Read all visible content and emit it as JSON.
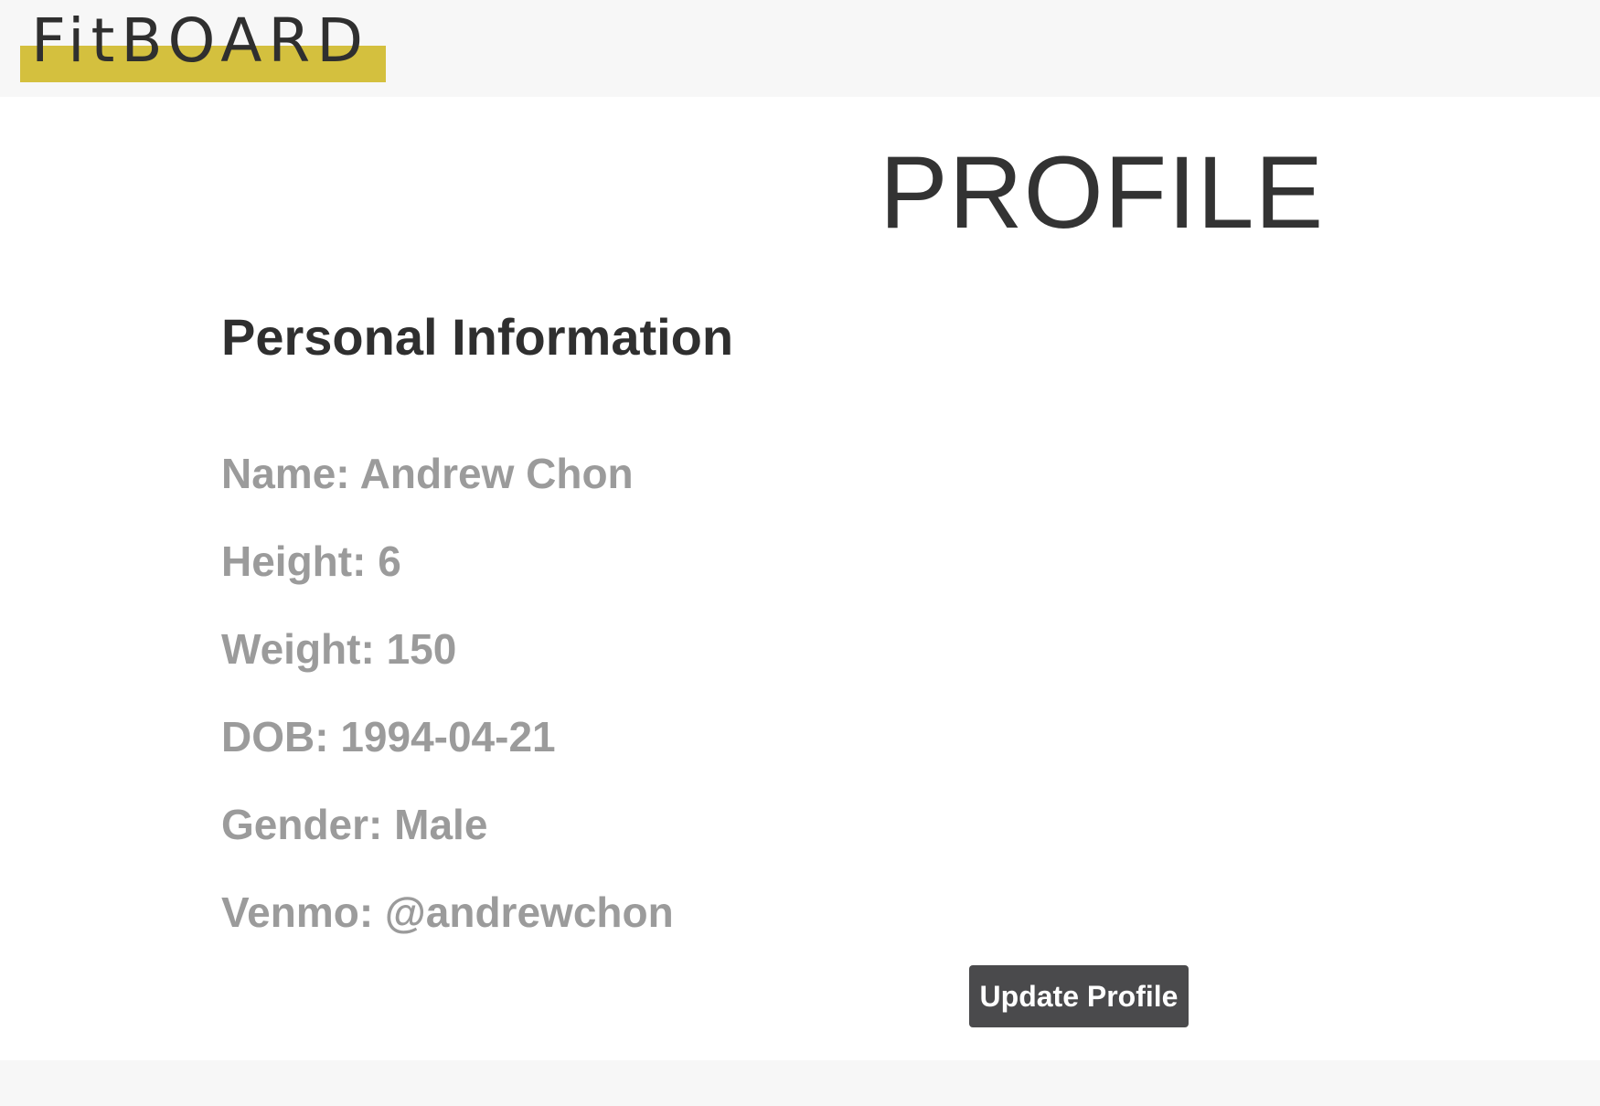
{
  "header": {
    "logo_text": "FitBOARD",
    "logo_accent_color": "#d4c03e"
  },
  "main": {
    "title": "PROFILE",
    "section_heading": "Personal Information",
    "info": [
      "Name: Andrew Chon",
      "Height: 6",
      "Weight: 150",
      "DOB: 1994-04-21",
      "Gender: Male",
      "Venmo: @andrewchon"
    ],
    "update_button_label": "Update Profile"
  },
  "colors": {
    "text_dark": "#333333",
    "text_muted": "#9b9b9b",
    "button_bg": "#4a4a4c",
    "page_bg": "#ffffff",
    "chrome_bg": "#f7f7f7"
  }
}
